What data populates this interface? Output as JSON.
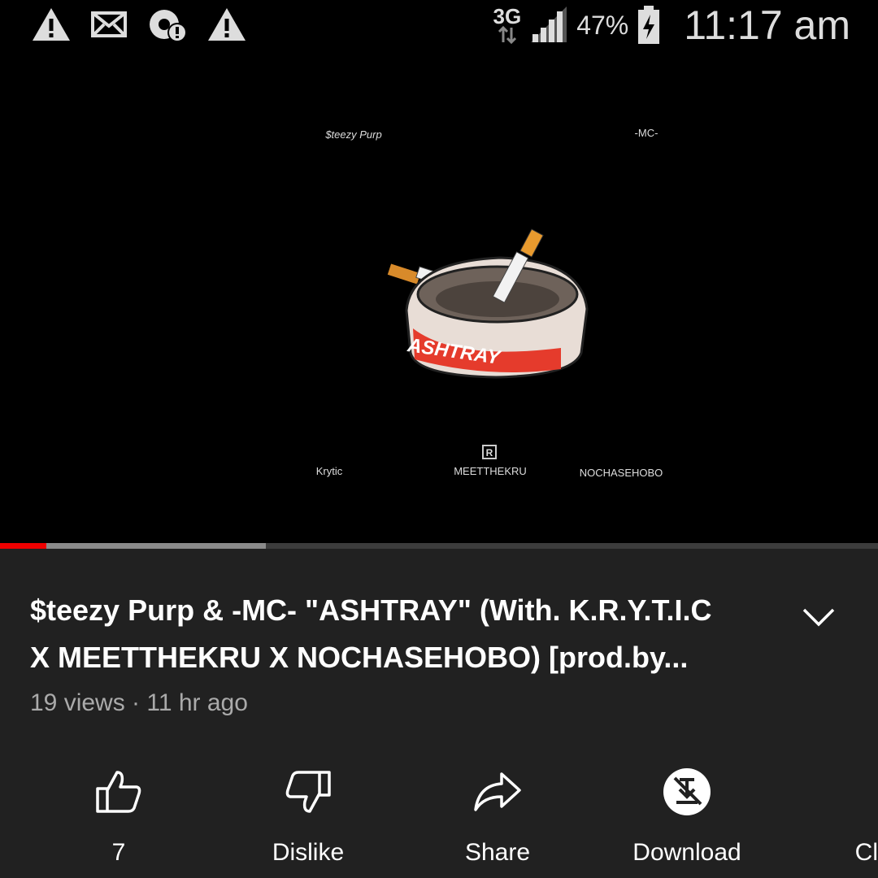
{
  "status_bar": {
    "icons_left": [
      "warning-icon",
      "mail-icon",
      "sync-alert-icon",
      "warning-icon"
    ],
    "network": "3G",
    "battery_percent": "47%",
    "time": "11:17 am"
  },
  "player": {
    "cover_art": {
      "artist_top_left": "$teezy Purp",
      "artist_top_right": "-MC-",
      "product_name": "ASHTRAY",
      "bottom_left": "Krytic",
      "bottom_center_mark": "R",
      "bottom_center": "MEETTHEKRU",
      "bottom_right": "NOCHASEHOBO"
    },
    "progress": {
      "played": 0.053,
      "buffered": 0.303
    }
  },
  "video": {
    "title_line1": "$teezy Purp & -MC- \"ASHTRAY\" (With. K.R.Y.T.I.C",
    "title_line2": "X MEETTHEKRU X NOCHASEHOBO) [prod.by...",
    "meta": "19 views · 11 hr ago"
  },
  "actions": [
    {
      "label": "7",
      "icon": "thumbs-up-icon"
    },
    {
      "label": "Dislike",
      "icon": "thumbs-down-icon"
    },
    {
      "label": "Share",
      "icon": "share-icon"
    },
    {
      "label": "Download",
      "icon": "download-disabled-icon"
    },
    {
      "label": "Cl",
      "icon": "clip-icon"
    }
  ],
  "colors": {
    "background": "#212121",
    "player_bg": "#000000",
    "progress_played": "#ee0000",
    "meta_text": "#aaaaaa"
  }
}
